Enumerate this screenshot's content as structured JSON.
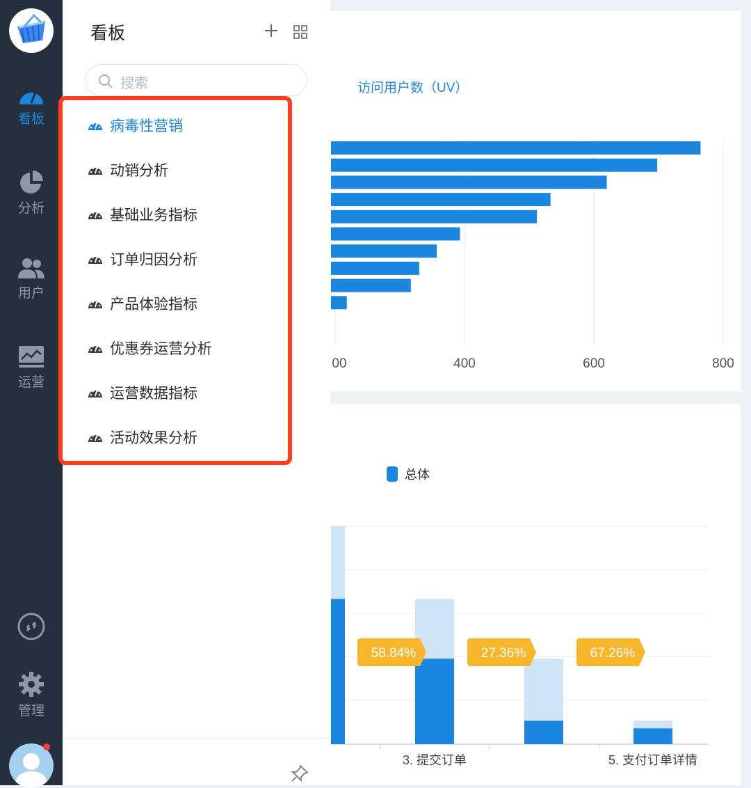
{
  "rail": {
    "items": [
      {
        "label": "看板",
        "icon": "dashboard-gauge-icon",
        "active": true
      },
      {
        "label": "分析",
        "icon": "pie-chart-icon",
        "active": false
      },
      {
        "label": "用户",
        "icon": "users-icon",
        "active": false
      },
      {
        "label": "运营",
        "icon": "monitor-chart-icon",
        "active": false
      }
    ],
    "bottom_items": [
      {
        "label": "",
        "icon": "link-icon"
      },
      {
        "label": "管理",
        "icon": "gear-icon"
      }
    ]
  },
  "panel": {
    "title": "看板",
    "search_placeholder": "搜索",
    "items": [
      {
        "label": "病毒性营销",
        "icon": "dashboard-gauge-icon",
        "active": true
      },
      {
        "label": "动销分析",
        "icon": "dashboard-gauge-icon",
        "active": false
      },
      {
        "label": "基础业务指标",
        "icon": "dashboard-gauge-icon",
        "active": false
      },
      {
        "label": "订单归因分析",
        "icon": "dashboard-gauge-icon",
        "active": false
      },
      {
        "label": "产品体验指标",
        "icon": "dashboard-gauge-icon",
        "active": false
      },
      {
        "label": "优惠券运营分析",
        "icon": "dashboard-gauge-icon",
        "active": false
      },
      {
        "label": "运营数据指标",
        "icon": "dashboard-gauge-icon",
        "active": false
      },
      {
        "label": "活动效果分析",
        "icon": "dashboard-gauge-icon",
        "active": false
      }
    ]
  },
  "colors": {
    "accent": "#1a86e0",
    "highlight": "#ff3d1f",
    "badge": "#f7b62c",
    "bar_light": "#cfe4f7"
  },
  "chart_data": [
    {
      "type": "bar",
      "orientation": "horizontal",
      "title": "访问用户数（UV）",
      "x_ticks": [
        "00",
        "400",
        "600",
        "800"
      ],
      "values": [
        765,
        698,
        620,
        533,
        512,
        393,
        357,
        330,
        317,
        218
      ]
    },
    {
      "type": "bar",
      "title": "",
      "legend": [
        "总体"
      ],
      "categories": [
        "",
        "3. 提交订单",
        "",
        "5. 支付订单详情"
      ],
      "series": [
        {
          "name": "总体",
          "values": [
            100,
            58.84,
            16.1,
            10.83
          ]
        }
      ],
      "upper_values": [
        150,
        100,
        58.84,
        16.1
      ],
      "conversion_labels": [
        "58.84%",
        "27.36%",
        "67.26%"
      ],
      "ylim": [
        0,
        150
      ]
    }
  ]
}
